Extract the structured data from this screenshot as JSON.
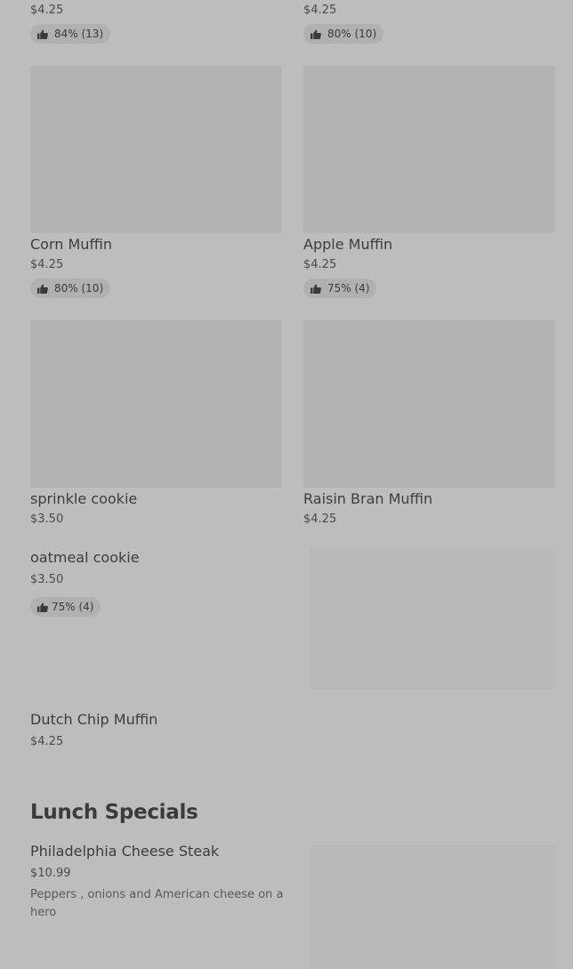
{
  "items": {
    "top_left": {
      "price": "$4.25",
      "rating": "84% (13)"
    },
    "top_right": {
      "price": "$4.25",
      "rating": "80% (10)"
    },
    "corn_muffin": {
      "name": "Corn Muffin",
      "price": "$4.25",
      "rating": "80% (10)"
    },
    "apple_muffin": {
      "name": "Apple Muffin",
      "price": "$4.25",
      "rating": "75% (4)"
    },
    "sprinkle_cookie": {
      "name": "sprinkle cookie",
      "price": "$3.50"
    },
    "raisin_bran_muffin": {
      "name": "Raisin Bran Muffin",
      "price": "$4.25"
    },
    "oatmeal_cookie": {
      "name": "oatmeal cookie",
      "price": "$3.50",
      "rating": "75% (4)"
    },
    "dutch_chip_muffin": {
      "name": "Dutch Chip Muffin",
      "price": "$4.25"
    }
  },
  "lunch_specials": {
    "title": "Lunch Specials",
    "item": {
      "name": "Philadelphia Cheese Steak",
      "price": "$10.99",
      "description": "Peppers , onions and American cheese on a hero"
    }
  },
  "icons": {
    "rating": "thumbs-up-icon"
  },
  "colors": {
    "overlay_bg": "#bdbdbd",
    "badge_bg": "#b0b0b0",
    "placeholder": "#b3b3b3"
  }
}
